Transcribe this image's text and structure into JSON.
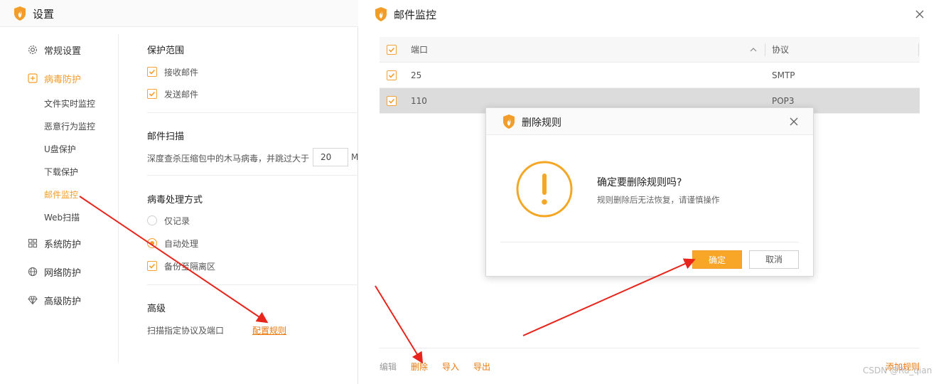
{
  "settings": {
    "title": "设置",
    "nav": [
      {
        "label": "常规设置",
        "icon": "gear-icon"
      },
      {
        "label": "病毒防护",
        "icon": "plus-box-icon",
        "active": true
      },
      {
        "label": "系统防护",
        "icon": "grid-icon"
      },
      {
        "label": "网络防护",
        "icon": "globe-icon"
      },
      {
        "label": "高级防护",
        "icon": "diamond-icon"
      }
    ],
    "sub_nav": [
      "文件实时监控",
      "恶意行为监控",
      "U盘保护",
      "下载保护",
      "邮件监控",
      "Web扫描"
    ],
    "protect_scope": {
      "title": "保护范围",
      "receive": "接收邮件",
      "send": "发送邮件"
    },
    "mail_scan": {
      "title": "邮件扫描",
      "desc": "深度查杀压缩包中的木马病毒，并跳过大于",
      "size": "20",
      "unit": "M"
    },
    "virus_handling": {
      "title": "病毒处理方式",
      "opt_record": "仅记录",
      "opt_auto": "自动处理",
      "backup": "备份至隔离区"
    },
    "advanced": {
      "title": "高级",
      "desc": "扫描指定协议及端口",
      "link": "配置规则"
    }
  },
  "mail_monitor": {
    "title": "邮件监控",
    "columns": {
      "port": "端口",
      "protocol": "协议"
    },
    "rows": [
      {
        "port": "25",
        "protocol": "SMTP"
      },
      {
        "port": "110",
        "protocol": "POP3"
      }
    ],
    "footer": {
      "edit": "编辑",
      "delete": "删除",
      "import": "导入",
      "export": "导出",
      "add": "添加规则"
    }
  },
  "dialog": {
    "title": "删除规则",
    "heading": "确定要删除规则吗?",
    "message": "规则删除后无法恢复，请谨慎操作",
    "ok": "确定",
    "cancel": "取消"
  },
  "watermark": "CSDN @Ru_qian",
  "colors": {
    "accent": "#f29d2a",
    "link": "#e8780c",
    "arrow": "#e8241b",
    "selected_row": "#dcdcdc"
  }
}
